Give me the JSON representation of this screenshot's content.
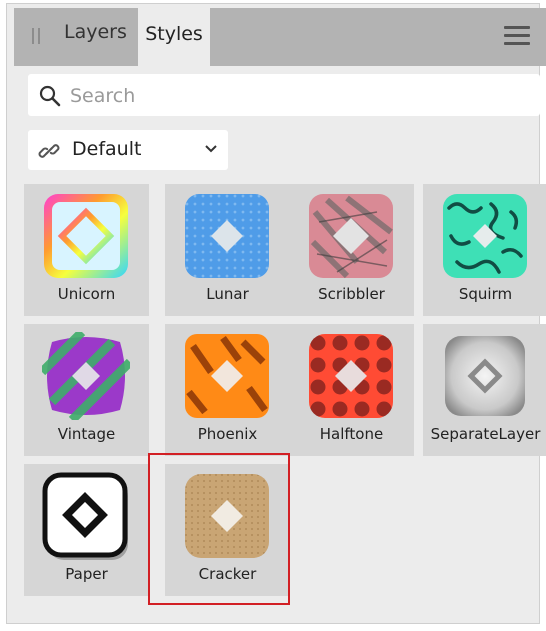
{
  "tabs": [
    {
      "label": "Layers",
      "active": false
    },
    {
      "label": "Styles",
      "active": true
    }
  ],
  "search": {
    "placeholder": "Search",
    "value": ""
  },
  "category": {
    "selected": "Default"
  },
  "styles": [
    {
      "label": "Unicorn",
      "icon": "unicorn-style-icon"
    },
    {
      "label": "Lunar",
      "icon": "lunar-style-icon"
    },
    {
      "label": "Scribbler",
      "icon": "scribbler-style-icon"
    },
    {
      "label": "Squirm",
      "icon": "squirm-style-icon"
    },
    {
      "label": "Vintage",
      "icon": "vintage-style-icon"
    },
    {
      "label": "Phoenix",
      "icon": "phoenix-style-icon"
    },
    {
      "label": "Halftone",
      "icon": "halftone-style-icon"
    },
    {
      "label": "SeparateLayer",
      "icon": "separatelayer-style-icon"
    },
    {
      "label": "Paper",
      "icon": "paper-style-icon"
    },
    {
      "label": "Cracker",
      "icon": "cracker-style-icon",
      "highlighted": true
    }
  ],
  "colors": {
    "highlight": "#d21f24",
    "tabbar": "#b3b3b3",
    "panel": "#ececec",
    "tile": "#d6d6d6"
  }
}
